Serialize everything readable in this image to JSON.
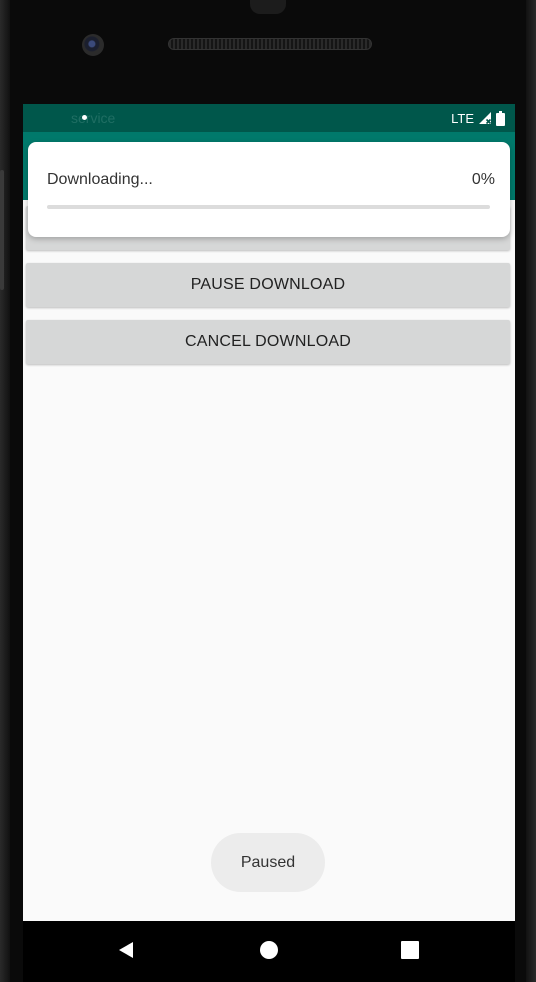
{
  "status_bar": {
    "app_name": "service",
    "network": "LTE",
    "signal_icon": "signal-no-data-icon",
    "battery_icon": "battery-full-icon"
  },
  "buttons": {
    "pause": "PAUSE DOWNLOAD",
    "cancel": "CANCEL DOWNLOAD"
  },
  "notification": {
    "title": "Downloading...",
    "percent": "0%",
    "progress": 0
  },
  "toast": {
    "text": "Paused"
  },
  "nav": {
    "back_icon": "back-triangle-icon",
    "home_icon": "home-circle-icon",
    "recents_icon": "recents-square-icon"
  },
  "colors": {
    "status_bar": "#00574b",
    "app_bar": "#00796b",
    "button": "#d6d7d7",
    "screen_bg": "#fafafa"
  }
}
